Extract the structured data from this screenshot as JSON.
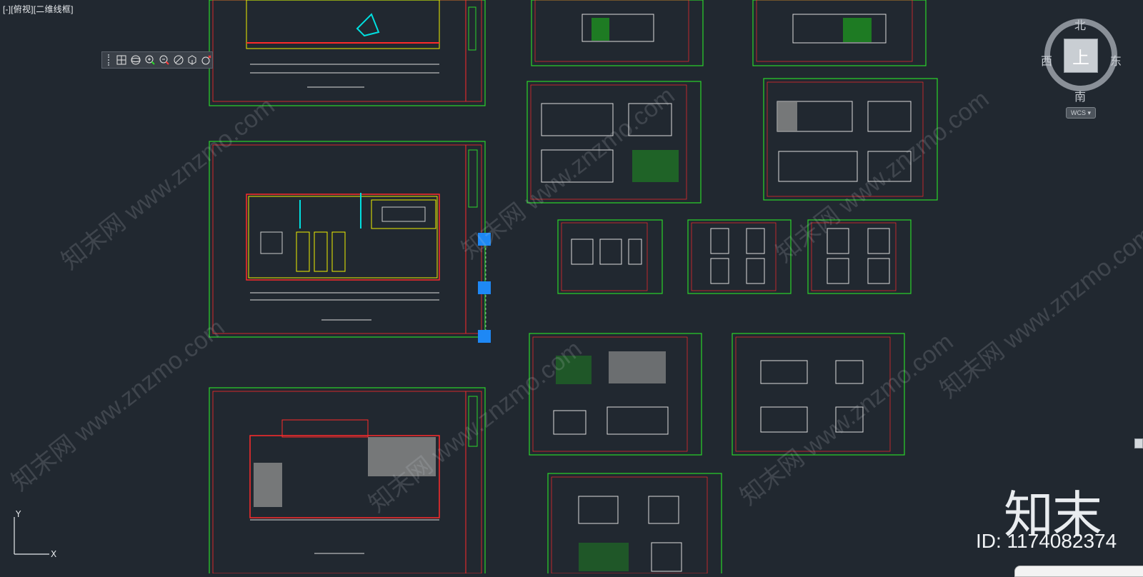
{
  "viewport": {
    "label": "[-][俯视][二维线框]"
  },
  "toolbar": {
    "buttons": [
      {
        "name": "grid-icon"
      },
      {
        "name": "orbit-icon"
      },
      {
        "name": "zoom-in-icon"
      },
      {
        "name": "zoom-out-icon"
      },
      {
        "name": "pan-icon"
      },
      {
        "name": "cube-view-icon"
      },
      {
        "name": "close-icon"
      }
    ]
  },
  "viewcube": {
    "north": "北",
    "south": "南",
    "west": "西",
    "east": "东",
    "face": "上",
    "wcs": "WCS"
  },
  "ucs": {
    "x": "X",
    "y": "Y"
  },
  "brand": {
    "logo": "知末",
    "id": "ID: 1174082374"
  },
  "watermarks": [
    "知末网 www.znzmo.com",
    "知末网 www.znzmo.com",
    "知末网 www.znzmo.com",
    "知末网 www.znzmo.com",
    "知末网 www.znzmo.com",
    "知末网 www.znzmo.com",
    "知末网 www.znzmo.com"
  ],
  "colors": {
    "background": "#212830",
    "frame": "#2bd62b",
    "wall": "#ff2a2a",
    "furniture": "#f0f000",
    "cyan": "#00e0e0",
    "grip": "#1e88f5"
  }
}
